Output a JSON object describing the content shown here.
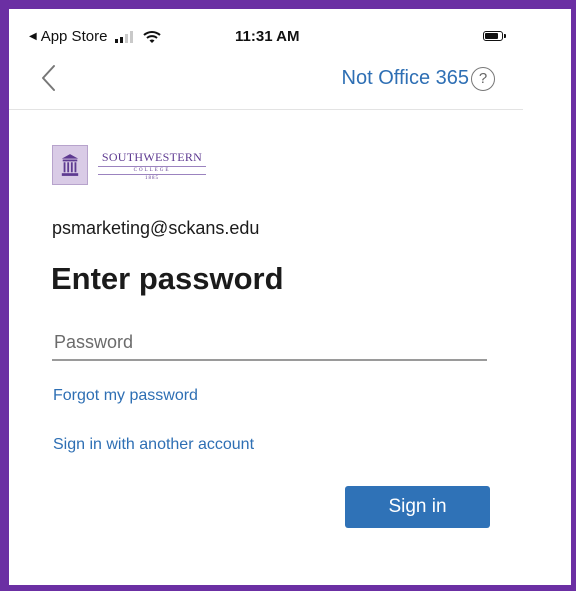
{
  "status_bar": {
    "back_app": "App Store",
    "time": "11:31 AM",
    "icons": [
      "back-triangle-icon",
      "cellular-signal-icon",
      "wifi-icon",
      "battery-icon"
    ]
  },
  "nav": {
    "back_icon": "chevron-left-icon",
    "not_office_label": "Not Office 365",
    "help_label": "?"
  },
  "logo": {
    "name": "SOUTHWESTERN",
    "sub": "COLLEGE",
    "year": "1885"
  },
  "account": {
    "email": "psmarketing@sckans.edu"
  },
  "form": {
    "title": "Enter password",
    "password_placeholder": "Password",
    "password_value": "",
    "forgot_label": "Forgot my password",
    "another_account_label": "Sign in with another account",
    "sign_in_label": "Sign in"
  },
  "colors": {
    "frame": "#6b2fa3",
    "link": "#2e6fb4",
    "primary_button": "#2f72b7",
    "logo_purple": "#5e3a91"
  }
}
